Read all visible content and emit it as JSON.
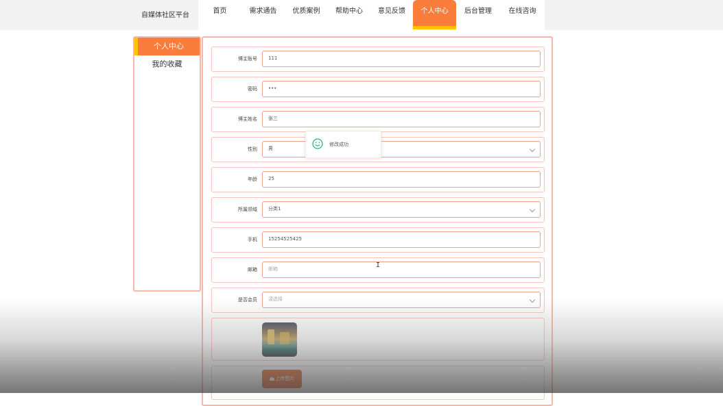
{
  "header": {
    "brand": "自媒体社区平台",
    "nav": [
      {
        "label": "首页",
        "active": false
      },
      {
        "label": "需求通告",
        "active": false
      },
      {
        "label": "优质案例",
        "active": false
      },
      {
        "label": "帮助中心",
        "active": false
      },
      {
        "label": "意见反馈",
        "active": false
      },
      {
        "label": "个人中心",
        "active": true
      },
      {
        "label": "后台管理",
        "active": false
      },
      {
        "label": "在线咨询",
        "active": false
      }
    ]
  },
  "sidebar": {
    "items": [
      {
        "label": "个人中心",
        "active": true
      },
      {
        "label": "我的收藏",
        "active": false
      }
    ]
  },
  "form": {
    "fields": [
      {
        "label": "博主账号",
        "value": "111",
        "type": "text"
      },
      {
        "label": "密码",
        "value": "•••",
        "type": "password"
      },
      {
        "label": "博主姓名",
        "value": "张三",
        "type": "text"
      },
      {
        "label": "性别",
        "value": "男",
        "type": "select"
      },
      {
        "label": "年龄",
        "value": "25",
        "type": "text"
      },
      {
        "label": "所属领域",
        "value": "分类1",
        "type": "select"
      },
      {
        "label": "手机",
        "value": "15254525425",
        "type": "text"
      },
      {
        "label": "邮箱",
        "value": "邮箱",
        "type": "placeholder"
      },
      {
        "label": "是否会员",
        "value": "请选择",
        "type": "select-placeholder"
      }
    ],
    "upload_label": "上传图片"
  },
  "toast": {
    "message": "修改成功"
  },
  "colors": {
    "accent": "#fa7d3c",
    "accent_bar": "#ffc400",
    "border": "#f6b6a8",
    "success": "#2bb673"
  }
}
